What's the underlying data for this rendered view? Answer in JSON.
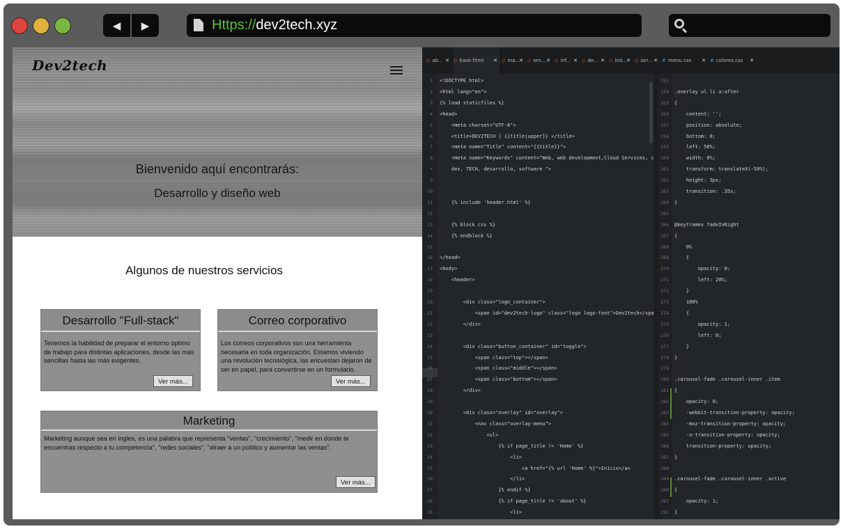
{
  "browser": {
    "url_scheme": "Https://",
    "url_host": "dev2tech.xyz",
    "back_glyph": "◀",
    "forward_glyph": "▶"
  },
  "site": {
    "logo": "Dev2tech",
    "hero_line1": "Bienvenido aquí encontrarás:",
    "hero_line2": "Desarrollo y diseño web",
    "services_title": "Algunos de nuestros servicios",
    "cards": [
      {
        "title": "Desarrollo \"Full-stack\"",
        "text": "Tenemos la habilidad de preparar el entorno óptimo de trabajo para distintas aplicaciones, desde las más sencillas hasta las más exigentes.",
        "button": "Ver más..."
      },
      {
        "title": "Correo corporativo",
        "text": "Los correos corporativos son una herramienta necesaria en toda organización. Estamos viviendo una revolución tecnológica, las encuestan dejaron de ser en papel, para convertirse en un formulario.",
        "button": "Ver más..."
      },
      {
        "title": "Marketing",
        "text": "Marketing aunque sea en ingles, es una palabra que representa \"ventas\", \"crecimiento\", \"medir en donde te encuentras respecto a tu competencia\", \"redes sociales\", \"atraer a un público y aumentar las ventas\".",
        "button": "Ver más..."
      }
    ]
  },
  "editor": {
    "tabs": [
      "ab...",
      "base.html",
      "ma...",
      "om...",
      "inf...",
      "de...",
      "ind...",
      "ser...",
      "menu.css",
      "colores.css"
    ],
    "left_lines": [
      {
        "n": "1",
        "t": "<!DOCTYPE html>"
      },
      {
        "n": "2",
        "t": "<html lang=\"en\">"
      },
      {
        "n": "3",
        "t": "{% load staticfiles %}"
      },
      {
        "n": "4",
        "t": "<head>"
      },
      {
        "n": "5",
        "t": "    <meta charset=\"UTF-8\">"
      },
      {
        "n": "6",
        "t": "    <title>DEV2TECH | {{title|upper}} </title>"
      },
      {
        "n": "7",
        "t": "    <meta name=\"Title\" content=\"{{title}}\">"
      },
      {
        "n": "8",
        "t": "    <meta name=\"Keywords\" content=\"Web, web development,Cloud Services, cloud,"
      },
      {
        "n": "•",
        "t": "    dev, TECH, desarrollo, software \">"
      },
      {
        "n": "9",
        "t": ""
      },
      {
        "n": "10",
        "t": ""
      },
      {
        "n": "11",
        "t": "    {% include 'header.html' %}"
      },
      {
        "n": "12",
        "t": ""
      },
      {
        "n": "13",
        "t": "    {% block css %}"
      },
      {
        "n": "14",
        "t": "    {% endblock %}"
      },
      {
        "n": "15",
        "t": ""
      },
      {
        "n": "16",
        "t": "</head>"
      },
      {
        "n": "17",
        "t": "<body>"
      },
      {
        "n": "18",
        "t": "    <header>"
      },
      {
        "n": "19",
        "t": ""
      },
      {
        "n": "20",
        "t": "        <div class=\"logo_container\">"
      },
      {
        "n": "21",
        "t": "            <span id=\"dev2tech-logo\" class=\"logo logo-font\">Dev2tech</span>"
      },
      {
        "n": "22",
        "t": "        </div>"
      },
      {
        "n": "23",
        "t": ""
      },
      {
        "n": "24",
        "t": "        <div class=\"button_container\" id=\"toggle\">"
      },
      {
        "n": "25",
        "t": "            <span class=\"top\"></span>"
      },
      {
        "n": "26",
        "t": "            <span class=\"middle\"></span>"
      },
      {
        "n": "27",
        "t": "            <span class=\"bottom\"></span>"
      },
      {
        "n": "28",
        "t": "        </div>"
      },
      {
        "n": "29",
        "t": ""
      },
      {
        "n": "30",
        "t": "        <div class=\"overlay\" id=\"overlay\">"
      },
      {
        "n": "31",
        "t": "            <nav class=\"overlay-menu\">"
      },
      {
        "n": "32",
        "t": "                <ul>"
      },
      {
        "n": "33",
        "t": "                    {% if page_title != 'Home' %}"
      },
      {
        "n": "34",
        "t": "                        <li>"
      },
      {
        "n": "35",
        "t": "                            <a href=\"{% url 'Home' %}\">Inicio</a>"
      },
      {
        "n": "36",
        "t": "                        </li>"
      },
      {
        "n": "37",
        "t": "                    {% endif %}"
      },
      {
        "n": "38",
        "t": "                    {% if page_title != 'about' %}"
      },
      {
        "n": "39",
        "t": "                        <li>"
      }
    ],
    "right_lines": [
      {
        "n": "253",
        "t": ""
      },
      {
        "n": "254",
        "t": ".overlay ul li a:after"
      },
      {
        "n": "255",
        "t": "{"
      },
      {
        "n": "256",
        "t": "    content: '';"
      },
      {
        "n": "257",
        "t": "    position: absolute;"
      },
      {
        "n": "258",
        "t": "    bottom: 0;"
      },
      {
        "n": "259",
        "t": "    left: 50%;"
      },
      {
        "n": "260",
        "t": "    width: 0%;"
      },
      {
        "n": "261",
        "t": "    transform: translateX(-50%);"
      },
      {
        "n": "262",
        "t": "    height: 3px;"
      },
      {
        "n": "263",
        "t": "    transition: .35s;"
      },
      {
        "n": "264",
        "t": "}"
      },
      {
        "n": "265",
        "t": ""
      },
      {
        "n": "266",
        "t": "@keyframes fadeInRight"
      },
      {
        "n": "267",
        "t": "{"
      },
      {
        "n": "268",
        "t": "    0%"
      },
      {
        "n": "269",
        "t": "    {"
      },
      {
        "n": "270",
        "t": "        opacity: 0;"
      },
      {
        "n": "271",
        "t": "        left: 20%;"
      },
      {
        "n": "272",
        "t": "    }"
      },
      {
        "n": "273",
        "t": "    100%"
      },
      {
        "n": "274",
        "t": "    {"
      },
      {
        "n": "275",
        "t": "        opacity: 1;"
      },
      {
        "n": "276",
        "t": "        left: 0;"
      },
      {
        "n": "277",
        "t": "    }"
      },
      {
        "n": "278",
        "t": "}"
      },
      {
        "n": "279",
        "t": ""
      },
      {
        "n": "280",
        "t": ".carousel-fade .carousel-inner .item"
      },
      {
        "n": "281",
        "t": "{"
      },
      {
        "n": "282",
        "t": "    opacity: 0;"
      },
      {
        "n": "283",
        "t": "    -webkit-transition-property: opacity;"
      },
      {
        "n": "284",
        "t": "    -moz-transition-property: opacity;"
      },
      {
        "n": "285",
        "t": "    -o-transition-property: opacity;"
      },
      {
        "n": "286",
        "t": "    transition-property: opacity;"
      },
      {
        "n": "287",
        "t": "}"
      },
      {
        "n": "288",
        "t": ""
      },
      {
        "n": "289",
        "t": ".carousel-fade .carousel-inner .active"
      },
      {
        "n": "290",
        "t": "{"
      },
      {
        "n": "291",
        "t": "    opacity: 1;"
      },
      {
        "n": "292",
        "t": "}"
      }
    ]
  },
  "colors": {
    "url_scheme": "#58c234",
    "traffic_red": "#e0443e",
    "traffic_yellow": "#e2b13c",
    "traffic_green": "#79b83f",
    "editor_bg": "#232629"
  }
}
